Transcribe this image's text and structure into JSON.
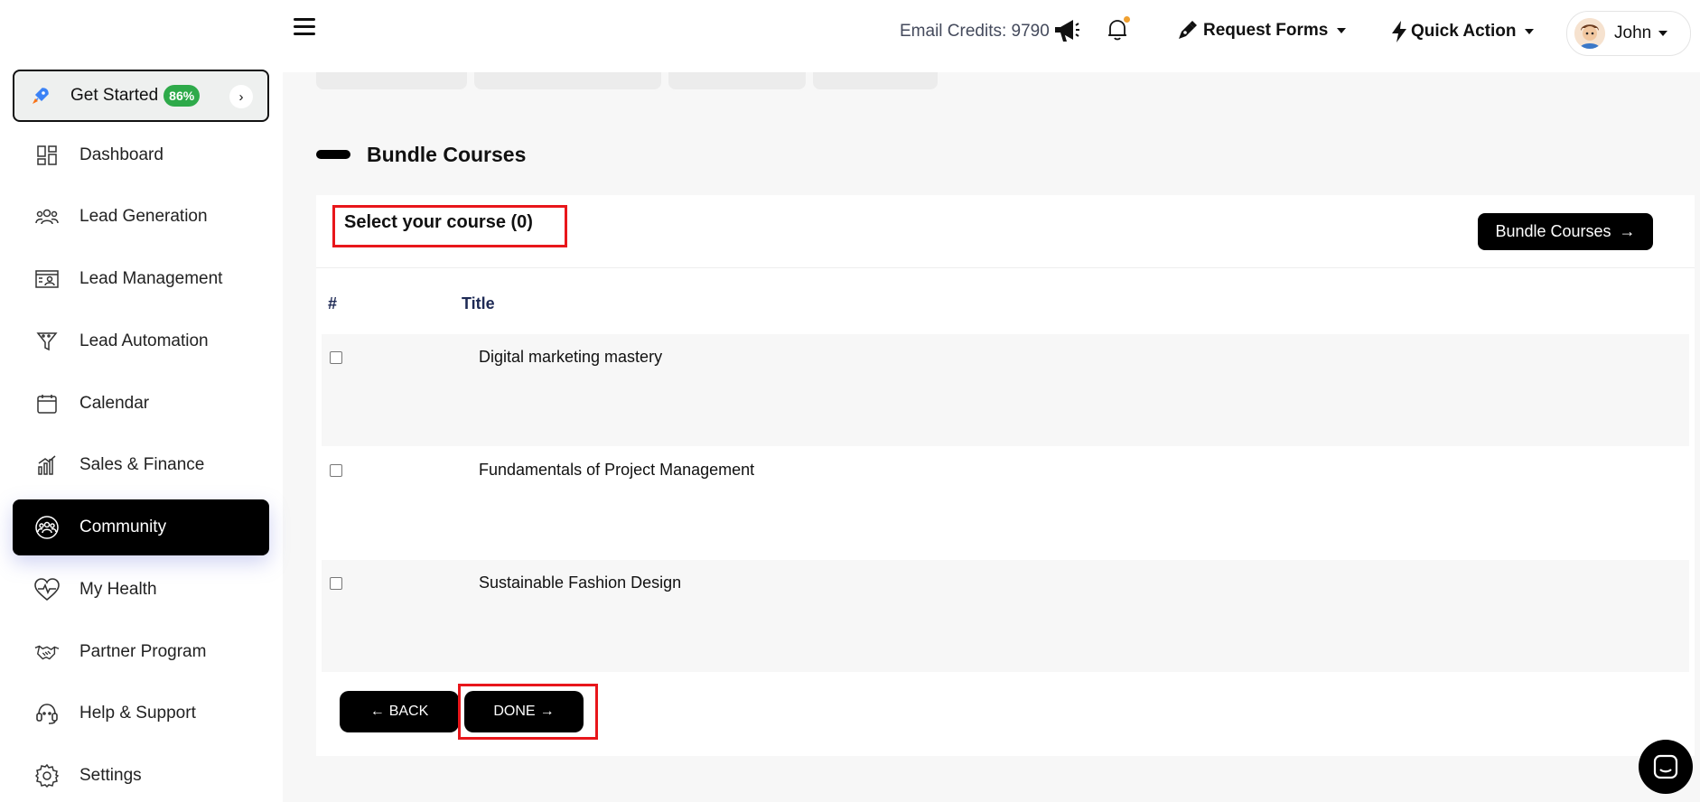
{
  "sidebar": {
    "get_started": {
      "label": "Get Started",
      "badge": "86%",
      "chevron": "›"
    },
    "items": [
      {
        "label": "Dashboard",
        "icon": "dashboard-icon"
      },
      {
        "label": "Lead Generation",
        "icon": "users-icon"
      },
      {
        "label": "Lead Management",
        "icon": "contact-card-icon"
      },
      {
        "label": "Lead Automation",
        "icon": "funnel-icon"
      },
      {
        "label": "Calendar",
        "icon": "calendar-icon"
      },
      {
        "label": "Sales & Finance",
        "icon": "bar-chart-icon"
      },
      {
        "label": "Community",
        "icon": "community-icon",
        "active": true
      },
      {
        "label": "My Health",
        "icon": "heart-pulse-icon"
      },
      {
        "label": "Partner Program",
        "icon": "handshake-icon"
      },
      {
        "label": "Help & Support",
        "icon": "headset-icon"
      },
      {
        "label": "Settings",
        "icon": "gear-icon"
      }
    ]
  },
  "header": {
    "email_credits": "Email Credits: 9790",
    "request_forms": "Request Forms",
    "quick_action": "Quick Action",
    "user_name": "John"
  },
  "main": {
    "section_title": "Bundle Courses",
    "select_title": "Select your course (0)",
    "bundle_button": "Bundle Courses",
    "table": {
      "columns": [
        "#",
        "Title"
      ],
      "rows": [
        {
          "title": "Digital marketing mastery",
          "checked": false
        },
        {
          "title": "Fundamentals of Project Management",
          "checked": false
        },
        {
          "title": "Sustainable Fashion Design",
          "checked": false
        }
      ]
    },
    "back_button": "BACK",
    "done_button": "DONE"
  },
  "colors": {
    "accent": "#000000",
    "badge_green": "#2eaa4a",
    "highlight_red": "#e8161b",
    "notification_dot": "#f0a030"
  }
}
